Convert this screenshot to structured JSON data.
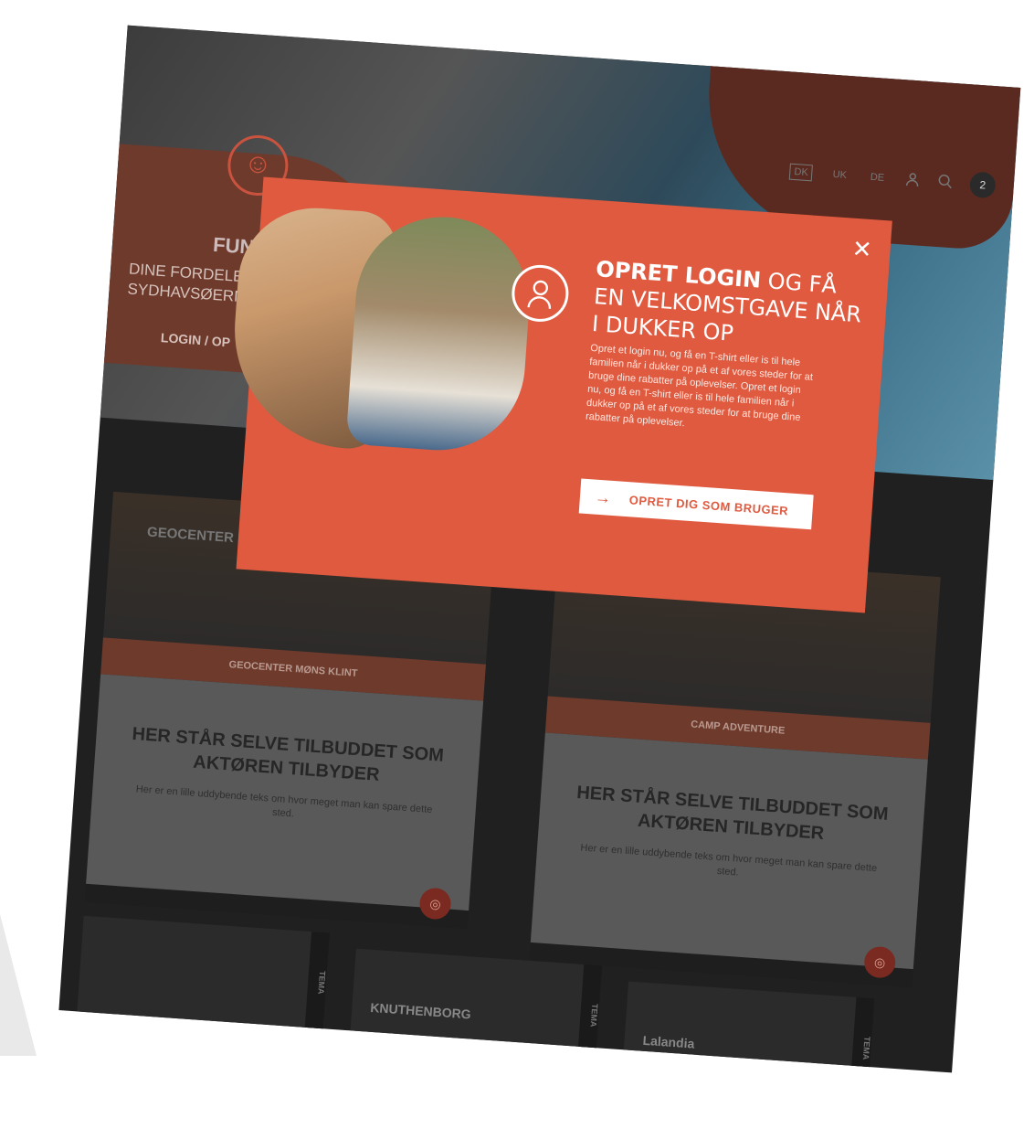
{
  "header": {
    "languages": [
      "DK",
      "UK",
      "DE"
    ],
    "active_language": "DK",
    "cart_count": "2"
  },
  "member_panel": {
    "title": "FUN",
    "subtitle": "DINE FORDELE SYDHAVSØERNE",
    "login_link": "LOGIN / OP"
  },
  "modal": {
    "title_bold": "OPRET LOGIN",
    "title_rest": " OG FÅ EN VELKOMSTGAVE NÅR I DUKKER OP",
    "description": "Opret et login nu, og få en T-shirt eller is til hele familien når i dukker op på et af vores steder for at bruge dine rabatter på oplevelser. Opret et login nu, og få en T-shirt eller is til hele familien når i dukker op på et af vores steder for at bruge dine rabatter på oplevelser.",
    "cta_label": "OPRET DIG SOM BRUGER",
    "close": "✕"
  },
  "cards": [
    {
      "brand": "GEOCENTER MØNS",
      "ribbon": "GEOCENTER MØNS KLINT",
      "heading": "HER STÅR SELVE TILBUDDET SOM AKTØREN TILBYDER",
      "text": "Her er en lille uddybende teks om hvor meget man kan spare dette sted."
    },
    {
      "brand": "",
      "ribbon": "CAMP ADVENTURE",
      "heading": "HER STÅR SELVE TILBUDDET SOM AKTØREN TILBYDER",
      "text": "Her er en lille uddybende teks om hvor meget man kan spare dette sted."
    }
  ],
  "tiles": [
    {
      "name": "",
      "tag": "TEMA"
    },
    {
      "name": "KNUTHENBORG",
      "tag": "TEMA"
    },
    {
      "name": "Lalandia",
      "tag": "TEMA"
    }
  ],
  "colors": {
    "modal": "#e05a40",
    "accent_dark": "#6e3a2c",
    "page_bg": "#202020"
  },
  "icons": {
    "profile": "user-outline-icon",
    "search": "search-icon",
    "close": "close-icon",
    "cta_arrow": "arrow-right-icon",
    "chat": "chat-icon",
    "smile": "smiley-icon"
  }
}
